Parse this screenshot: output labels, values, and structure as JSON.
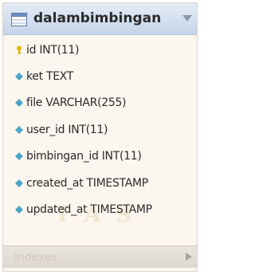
{
  "table": {
    "name": "dalambimbingan",
    "columns": [
      {
        "label": "id INT(11)",
        "icon": "primary-key-icon"
      },
      {
        "label": "ket TEXT",
        "icon": "column-diamond-icon"
      },
      {
        "label": "file VARCHAR(255)",
        "icon": "column-diamond-icon"
      },
      {
        "label": "user_id INT(11)",
        "icon": "column-diamond-icon"
      },
      {
        "label": "bimbingan_id INT(11)",
        "icon": "column-diamond-icon"
      },
      {
        "label": "created_at TIMESTAMP",
        "icon": "column-diamond-icon"
      },
      {
        "label": "updated_at TIMESTAMP",
        "icon": "column-diamond-icon"
      }
    ],
    "indexes_label": "Indexes"
  },
  "colors": {
    "header_gradient_top": "#e4ecf7",
    "header_gradient_bottom": "#c6d4e8",
    "key_icon": "#e6b800",
    "diamond_icon": "#4aa6c8",
    "card_background": "#fbf6ee"
  }
}
